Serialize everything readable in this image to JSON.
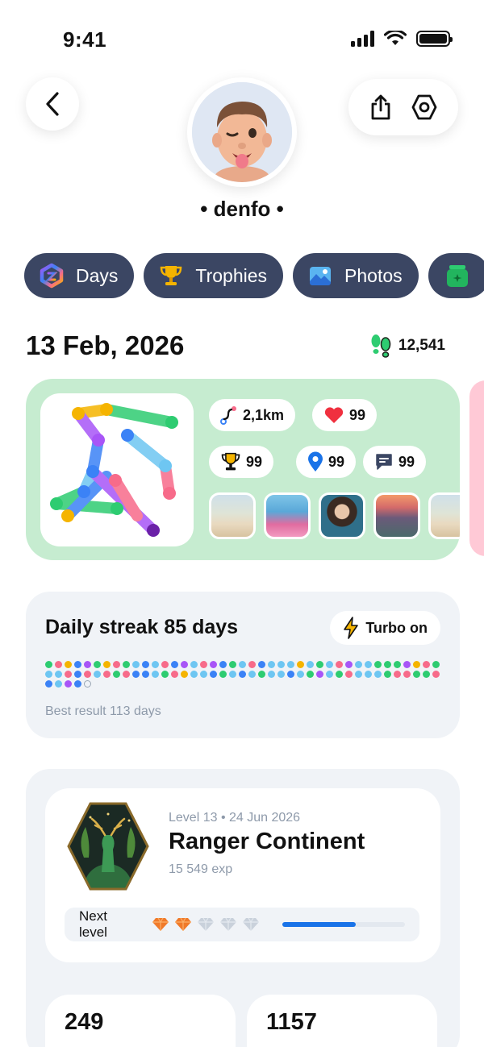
{
  "status": {
    "time": "9:41"
  },
  "profile": {
    "username": "• denfo •"
  },
  "tabs": [
    {
      "label": "Days",
      "icon": "hexagon-gradient-icon"
    },
    {
      "label": "Trophies",
      "icon": "trophy-icon"
    },
    {
      "label": "Photos",
      "icon": "photos-icon"
    },
    {
      "label": "",
      "icon": "green-jar-icon"
    }
  ],
  "day": {
    "date": "13 Feb, 2026",
    "steps": "12,541",
    "distance": "2,1km",
    "likes": "99",
    "trophies": "99",
    "places": "99",
    "comments": "99",
    "card_color": "#c6ecd0"
  },
  "streak": {
    "title": "Daily streak 85 days",
    "turbo_label": "Turbo on",
    "best": "Best result 113 days",
    "dot_colors": [
      "#2ecc71",
      "#f76b8a",
      "#f5b400",
      "#3b82f6",
      "#a855f7",
      "#2ecc71",
      "#f5b400",
      "#f76b8a",
      "#2ecc71",
      "#6ec6f2",
      "#3b82f6",
      "#6ec6f2",
      "#f76b8a",
      "#3b82f6",
      "#a855f7",
      "#6ec6f2",
      "#f76b8a",
      "#a855f7",
      "#3b82f6",
      "#2ecc71",
      "#6ec6f2",
      "#f76b8a",
      "#3b82f6",
      "#6ec6f2",
      "#6ec6f2",
      "#6ec6f2",
      "#f5b400",
      "#6ec6f2",
      "#2ecc71",
      "#6ec6f2",
      "#f76b8a",
      "#a855f7",
      "#6ec6f2",
      "#6ec6f2",
      "#2ecc71",
      "#2ecc71",
      "#2ecc71",
      "#a855f7",
      "#f5b400",
      "#f76b8a",
      "#2ecc71",
      "#6ec6f2",
      "#6ec6f2",
      "#f76b8a",
      "#3b82f6",
      "#f76b8a",
      "#6ec6f2",
      "#f76b8a",
      "#2ecc71",
      "#f76b8a",
      "#3b82f6",
      "#3b82f6",
      "#6ec6f2",
      "#2ecc71",
      "#f76b8a",
      "#f5b400",
      "#6ec6f2",
      "#6ec6f2",
      "#3b82f6",
      "#2ecc71",
      "#6ec6f2",
      "#3b82f6",
      "#6ec6f2",
      "#2ecc71",
      "#6ec6f2",
      "#6ec6f2",
      "#3b82f6",
      "#6ec6f2",
      "#2ecc71",
      "#a855f7",
      "#6ec6f2",
      "#2ecc71",
      "#f76b8a",
      "#6ec6f2",
      "#6ec6f2",
      "#6ec6f2",
      "#2ecc71",
      "#f76b8a",
      "#f76b8a",
      "#2ecc71",
      "#2ecc71",
      "#f76b8a",
      "#3b82f6",
      "#6ec6f2",
      "#a855f7",
      "#3b82f6"
    ],
    "empty_dots": 1
  },
  "level": {
    "meta": "Level 13 • 24 Jun 2026",
    "name": "Ranger Continent",
    "exp": "15 549 exp",
    "next_label": "Next level",
    "gems_filled": 2,
    "gems_total": 5,
    "progress": 0.6
  },
  "stats": [
    "249",
    "1157"
  ],
  "colors": {
    "tab_bg": "#3b4663",
    "accent": "#1a73e8",
    "card_bg": "#f0f3f7"
  }
}
